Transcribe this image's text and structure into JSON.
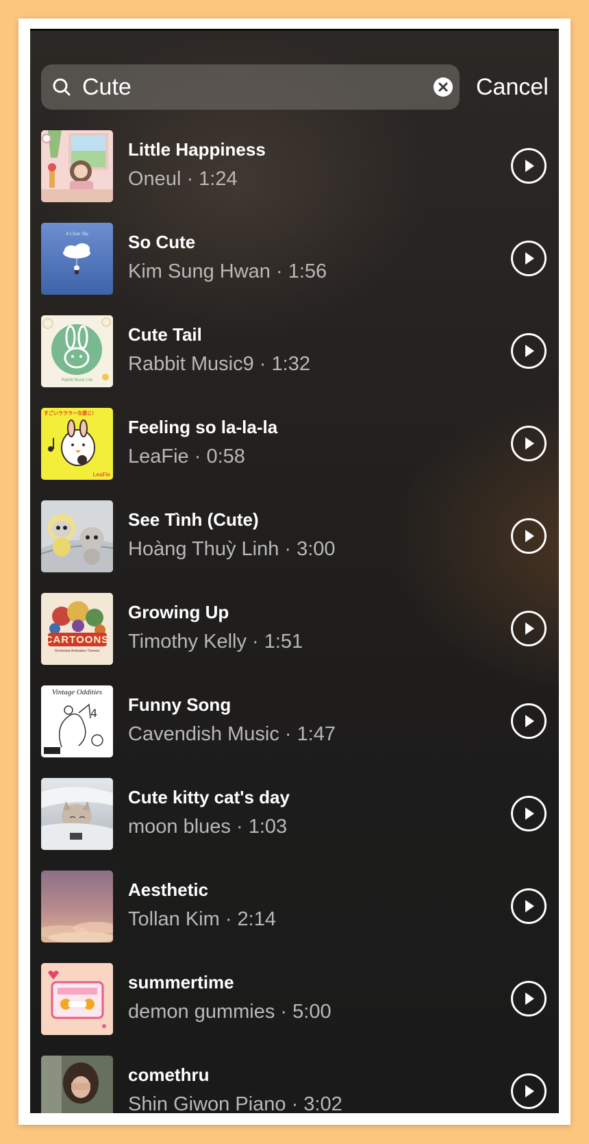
{
  "search": {
    "query": "Cute",
    "cancel_label": "Cancel"
  },
  "icons": {
    "search": "search-icon",
    "clear": "clear-icon",
    "play": "play-icon"
  },
  "colors": {
    "background_border": "#fcc67f",
    "text_primary": "#ffffff",
    "text_secondary": "#b9b9b9"
  },
  "tracks": [
    {
      "title": "Little Happiness",
      "subtitle": "Oneul · 1:24",
      "art": "artwork-little-happiness"
    },
    {
      "title": "So Cute",
      "subtitle": "Kim Sung Hwan · 1:56",
      "art": "artwork-so-cute",
      "art_text": "A Clear Sky"
    },
    {
      "title": "Cute Tail",
      "subtitle": "Rabbit Music9 · 1:32",
      "art": "artwork-cute-tail",
      "art_text": "Rabbit Music Life"
    },
    {
      "title": "Feeling so la-la-la",
      "subtitle": "LeaFie · 0:58",
      "art": "artwork-feeling-so-la-la-la",
      "art_text": "すごいラララーな感じ！",
      "art_text2": "LeaFie"
    },
    {
      "title": "See Tình (Cute)",
      "subtitle": "Hoàng Thuỳ Linh · 3:00",
      "art": "artwork-see-tinh"
    },
    {
      "title": "Growing Up",
      "subtitle": "Timothy Kelly · 1:51",
      "art": "artwork-growing-up",
      "art_text": "CARTOONS",
      "art_text2": "Orchestral Animation Themes"
    },
    {
      "title": "Funny Song",
      "subtitle": "Cavendish Music · 1:47",
      "art": "artwork-funny-song",
      "art_text": "Vintage Oddities"
    },
    {
      "title": "Cute kitty cat's day",
      "subtitle": "moon blues · 1:03",
      "art": "artwork-cute-kitty"
    },
    {
      "title": "Aesthetic",
      "subtitle": "Tollan Kim · 2:14",
      "art": "artwork-aesthetic"
    },
    {
      "title": "summertime",
      "subtitle": "demon gummies · 5:00",
      "art": "artwork-summertime"
    },
    {
      "title": "comethru",
      "subtitle": "Shin Giwon Piano · 3:02",
      "art": "artwork-comethru"
    }
  ]
}
